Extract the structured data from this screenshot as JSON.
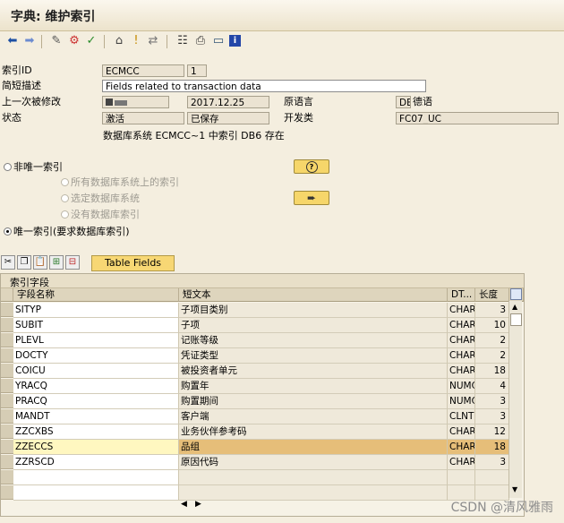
{
  "window": {
    "title": "字典: 维护索引"
  },
  "toolbar": {
    "icons": [
      "back-icon",
      "forward-icon",
      "display-change-icon",
      "other-object-icon",
      "check-icon",
      "activate-icon",
      "where-used-icon",
      "display-object-list-icon",
      "hierarchy-icon",
      "navigate-icon",
      "print-icon",
      "layout-icon",
      "info-icon"
    ]
  },
  "form": {
    "index_id_label": "索引ID",
    "index_table": "ECMCC",
    "index_id": "1",
    "short_desc_label": "简短描述",
    "short_desc": "Fields related to transaction data",
    "last_changed_label": "上一次被修改",
    "last_changed_user": "",
    "last_changed_date": "2017.12.25",
    "orig_lang_label": "原语言",
    "orig_lang_code": "DE",
    "orig_lang_name": "德语",
    "status_label": "状态",
    "status_value1": "激活",
    "status_value2": "已保存",
    "dev_class_label": "开发类",
    "dev_class": "FC07_UC",
    "db_info": "数据库系统 ECMCC~1 中索引 DB6 存在"
  },
  "options": {
    "non_unique": "非唯一索引",
    "all_db": "所有数据库系统上的索引",
    "selected_db": "选定数据库系统",
    "no_db": "没有数据库索引",
    "unique": "唯一索引(要求数据库索引)"
  },
  "table": {
    "toolbar_button": "Table Fields",
    "title": "索引字段",
    "headers": [
      "字段名称",
      "短文本",
      "DT...",
      "长度"
    ],
    "rows": [
      {
        "name": "SITYP",
        "text": "子项目类别",
        "dt": "CHAR",
        "len": "3"
      },
      {
        "name": "SUBIT",
        "text": "子项",
        "dt": "CHAR",
        "len": "10"
      },
      {
        "name": "PLEVL",
        "text": "记账等级",
        "dt": "CHAR",
        "len": "2"
      },
      {
        "name": "DOCTY",
        "text": "凭证类型",
        "dt": "CHAR",
        "len": "2"
      },
      {
        "name": "COICU",
        "text": "被投资者单元",
        "dt": "CHAR",
        "len": "18"
      },
      {
        "name": "YRACQ",
        "text": "购置年",
        "dt": "NUMC",
        "len": "4"
      },
      {
        "name": "PRACQ",
        "text": "购置期间",
        "dt": "NUMC",
        "len": "3"
      },
      {
        "name": "MANDT",
        "text": "客户端",
        "dt": "CLNT",
        "len": "3"
      },
      {
        "name": "ZZCXBS",
        "text": "业务伙伴参考码",
        "dt": "CHAR",
        "len": "12"
      },
      {
        "name": "ZZECCS",
        "text": "品组",
        "dt": "CHAR",
        "len": "18"
      },
      {
        "name": "ZZRSCD",
        "text": "原因代码",
        "dt": "CHAR",
        "len": "3"
      }
    ]
  },
  "watermark": "CSDN @清风雅雨",
  "colors": {
    "background": "#f4eedf",
    "button": "#f6d66a",
    "highlight": "#e6be79"
  }
}
